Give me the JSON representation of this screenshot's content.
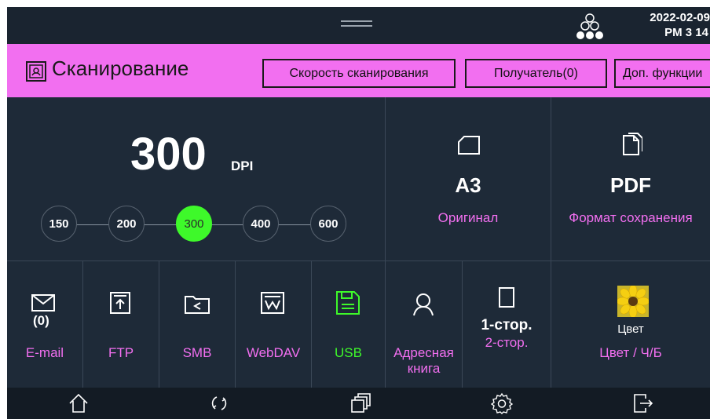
{
  "status": {
    "date": "2022-02-09",
    "time": "PM 3  14",
    "handle_icon": "drag-handle-icon",
    "network_icon": "network-icon"
  },
  "header": {
    "title": "Сканирование",
    "buttons": {
      "speed": "Скорость сканирования",
      "recipient": "Получатель(0)",
      "extra": "Доп. функции"
    }
  },
  "resolution": {
    "value": "300",
    "unit": "DPI",
    "options": [
      "150",
      "200",
      "300",
      "400",
      "600"
    ],
    "selected": "300",
    "active_color": "#3ef92a"
  },
  "original": {
    "value": "A3",
    "label": "Оригинал"
  },
  "format": {
    "value": "PDF",
    "label": "Формат сохранения"
  },
  "destinations": {
    "email": {
      "count": "(0)",
      "label": "E-mail"
    },
    "ftp": {
      "label": "FTP"
    },
    "smb": {
      "label": "SMB"
    },
    "webdav": {
      "label": "WebDAV"
    },
    "usb": {
      "label": "USB"
    },
    "addressbook": {
      "label_line1": "Адресная",
      "label_line2": "книга"
    }
  },
  "duplex": {
    "value": "1-стор.",
    "label": "2-стор."
  },
  "color": {
    "value": "Цвет",
    "label": "Цвет / Ч/Б"
  },
  "colors": {
    "accent": "#f26ff0",
    "background": "#1e2a38",
    "usb_green": "#3ef92a"
  },
  "nav": {
    "icons": [
      "home-icon",
      "refresh-icon",
      "windows-icon",
      "settings-icon",
      "logout-icon"
    ]
  }
}
